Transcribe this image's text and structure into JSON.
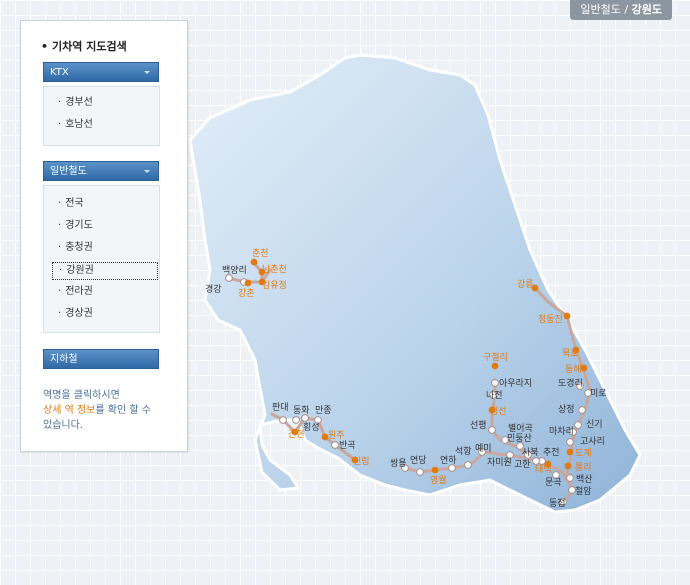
{
  "breadcrumb": {
    "part1": "일반철도",
    "sep": "/",
    "part2": "강원도"
  },
  "panel": {
    "title": "기차역 지도검색",
    "ktx": {
      "label": "KTX",
      "items": [
        "경부선",
        "호남선"
      ]
    },
    "general": {
      "label": "일반철도",
      "items": [
        "전국",
        "경기도",
        "충청권",
        "강원권",
        "전라권",
        "경상권"
      ],
      "selected": "강원권"
    },
    "subway": {
      "label": "지하철"
    },
    "info": {
      "line1": "역명을 클릭하시면",
      "line2_hl": "상세 역 정보",
      "line2_rest": "를 확인 할 수",
      "line3": "있습니다."
    }
  },
  "colors": {
    "line": "#c9a7a0",
    "station_orange": "#e07b12",
    "station_white": "#ffffff",
    "sea": "#a9c7e2"
  },
  "stations": [
    {
      "name": "경강",
      "orange": false
    },
    {
      "name": "백양리",
      "orange": false
    },
    {
      "name": "강촌",
      "orange": true
    },
    {
      "name": "김유정",
      "orange": true
    },
    {
      "name": "남춘천",
      "orange": true
    },
    {
      "name": "춘천",
      "orange": true
    },
    {
      "name": "강릉",
      "orange": true
    },
    {
      "name": "정동진",
      "orange": true
    },
    {
      "name": "묵호",
      "orange": true
    },
    {
      "name": "동해",
      "orange": true
    },
    {
      "name": "도경리",
      "orange": false
    },
    {
      "name": "미로",
      "orange": false
    },
    {
      "name": "상정",
      "orange": false
    },
    {
      "name": "신기",
      "orange": false
    },
    {
      "name": "마차리",
      "orange": false
    },
    {
      "name": "고사리",
      "orange": false
    },
    {
      "name": "도계",
      "orange": true
    },
    {
      "name": "통리",
      "orange": true
    },
    {
      "name": "백산",
      "orange": false
    },
    {
      "name": "철암",
      "orange": false
    },
    {
      "name": "동점",
      "orange": false
    },
    {
      "name": "문곡",
      "orange": false
    },
    {
      "name": "태백",
      "orange": true
    },
    {
      "name": "추전",
      "orange": false
    },
    {
      "name": "고한",
      "orange": false
    },
    {
      "name": "사북",
      "orange": false
    },
    {
      "name": "민둥산",
      "orange": false
    },
    {
      "name": "별어곡",
      "orange": false
    },
    {
      "name": "선평",
      "orange": false
    },
    {
      "name": "정선",
      "orange": true
    },
    {
      "name": "나전",
      "orange": false
    },
    {
      "name": "아우라지",
      "orange": false
    },
    {
      "name": "구절리",
      "orange": true
    },
    {
      "name": "자미원",
      "orange": false
    },
    {
      "name": "예미",
      "orange": false
    },
    {
      "name": "석항",
      "orange": false
    },
    {
      "name": "연하",
      "orange": false
    },
    {
      "name": "영월",
      "orange": true
    },
    {
      "name": "연당",
      "orange": false
    },
    {
      "name": "쌍용",
      "orange": false
    },
    {
      "name": "신림",
      "orange": true
    },
    {
      "name": "반곡",
      "orange": false
    },
    {
      "name": "원주",
      "orange": true
    },
    {
      "name": "만종",
      "orange": false
    },
    {
      "name": "동화",
      "orange": false
    },
    {
      "name": "횡성",
      "orange": false
    },
    {
      "name": "판대",
      "orange": false
    },
    {
      "name": "간현",
      "orange": true
    }
  ]
}
